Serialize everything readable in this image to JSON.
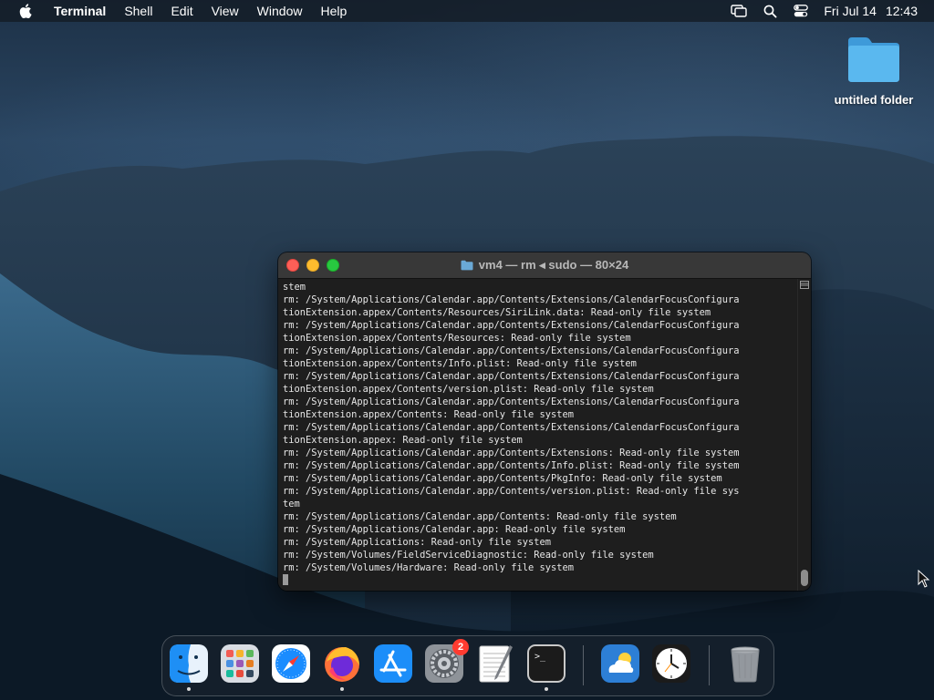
{
  "menubar": {
    "app_name": "Terminal",
    "menus": [
      "Shell",
      "Edit",
      "View",
      "Window",
      "Help"
    ],
    "date": "Fri Jul 14",
    "time": "12:43",
    "status_icons": [
      "screen-mirroring-icon",
      "spotlight-search-icon",
      "control-center-icon"
    ]
  },
  "desktop": {
    "folder_label": "untitled folder"
  },
  "terminal": {
    "title": "vm4 — rm ◂ sudo — 80×24",
    "lines": [
      "stem",
      "rm: /System/Applications/Calendar.app/Contents/Extensions/CalendarFocusConfigura",
      "tionExtension.appex/Contents/Resources/SiriLink.data: Read-only file system",
      "rm: /System/Applications/Calendar.app/Contents/Extensions/CalendarFocusConfigura",
      "tionExtension.appex/Contents/Resources: Read-only file system",
      "rm: /System/Applications/Calendar.app/Contents/Extensions/CalendarFocusConfigura",
      "tionExtension.appex/Contents/Info.plist: Read-only file system",
      "rm: /System/Applications/Calendar.app/Contents/Extensions/CalendarFocusConfigura",
      "tionExtension.appex/Contents/version.plist: Read-only file system",
      "rm: /System/Applications/Calendar.app/Contents/Extensions/CalendarFocusConfigura",
      "tionExtension.appex/Contents: Read-only file system",
      "rm: /System/Applications/Calendar.app/Contents/Extensions/CalendarFocusConfigura",
      "tionExtension.appex: Read-only file system",
      "rm: /System/Applications/Calendar.app/Contents/Extensions: Read-only file system",
      "rm: /System/Applications/Calendar.app/Contents/Info.plist: Read-only file system",
      "rm: /System/Applications/Calendar.app/Contents/PkgInfo: Read-only file system",
      "rm: /System/Applications/Calendar.app/Contents/version.plist: Read-only file sys",
      "tem",
      "rm: /System/Applications/Calendar.app/Contents: Read-only file system",
      "rm: /System/Applications/Calendar.app: Read-only file system",
      "rm: /System/Applications: Read-only file system",
      "rm: /System/Volumes/FieldServiceDiagnostic: Read-only file system",
      "rm: /System/Volumes/Hardware: Read-only file system"
    ]
  },
  "dock": {
    "items": [
      {
        "name": "finder-icon",
        "running": true
      },
      {
        "name": "launchpad-icon",
        "running": false
      },
      {
        "name": "safari-icon",
        "running": false
      },
      {
        "name": "firefox-icon",
        "running": true
      },
      {
        "name": "app-store-icon",
        "running": false
      },
      {
        "name": "system-settings-icon",
        "running": false,
        "badge": "2"
      },
      {
        "name": "textedit-icon",
        "running": false
      },
      {
        "name": "terminal-icon",
        "running": true
      },
      {
        "name": "weather-icon",
        "running": false
      },
      {
        "name": "clock-icon",
        "running": false
      },
      {
        "name": "trash-icon",
        "running": false
      }
    ]
  }
}
